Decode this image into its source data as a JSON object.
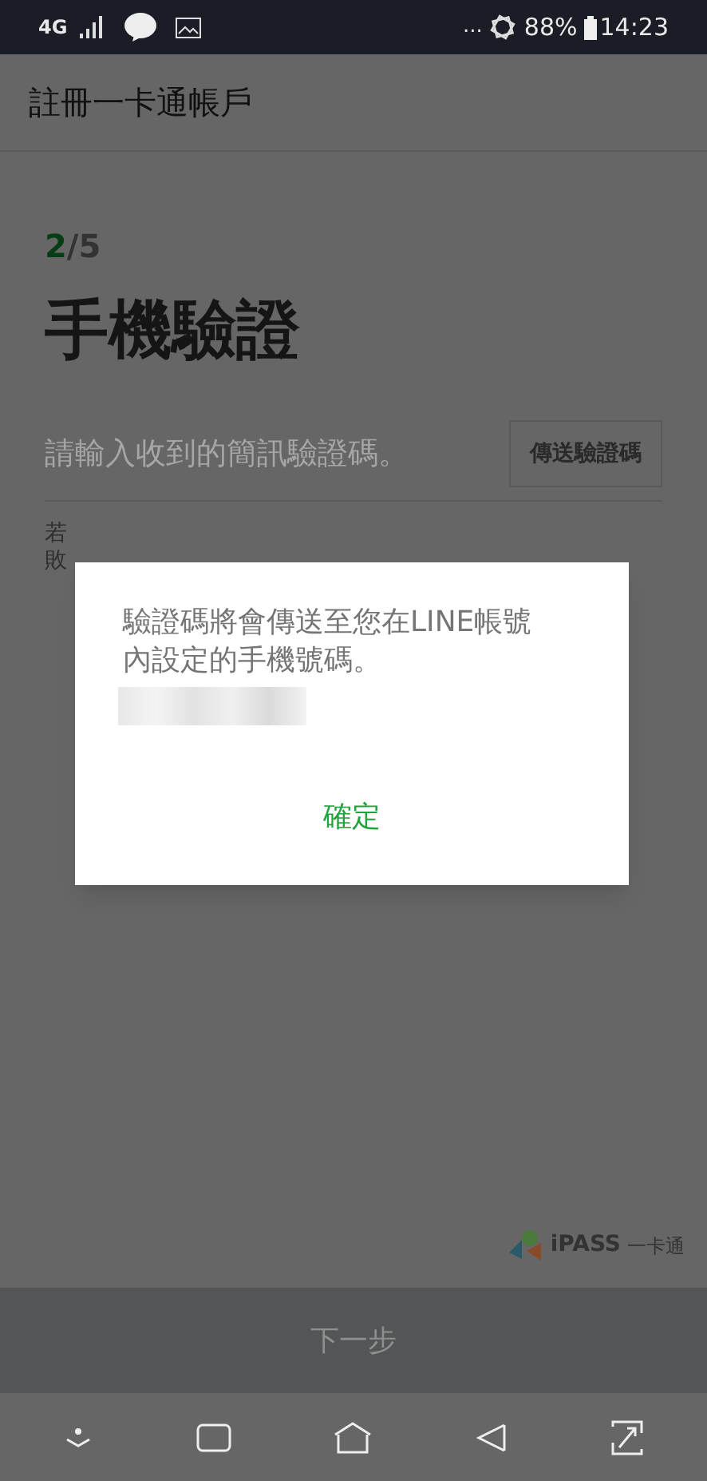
{
  "status_bar": {
    "network": "4G",
    "battery": "88%",
    "time": "14:23",
    "more": "..."
  },
  "app_bar": {
    "title": "註冊一卡通帳戶"
  },
  "step": {
    "current": "2",
    "total": "/5"
  },
  "heading": "手機驗證",
  "code_field": {
    "placeholder": "請輸入收到的簡訊驗證碼。"
  },
  "send_button": "傳送驗證碼",
  "helper_text": [
    "若",
    "敗"
  ],
  "dialog": {
    "message": "驗證碼將會傳送至您在LINE帳號內設定的手機號碼。",
    "confirm": "確定"
  },
  "logo": {
    "brand": "iPASS",
    "name": "一卡通"
  },
  "next_button": {
    "label": "下一步",
    "disabled": true
  }
}
